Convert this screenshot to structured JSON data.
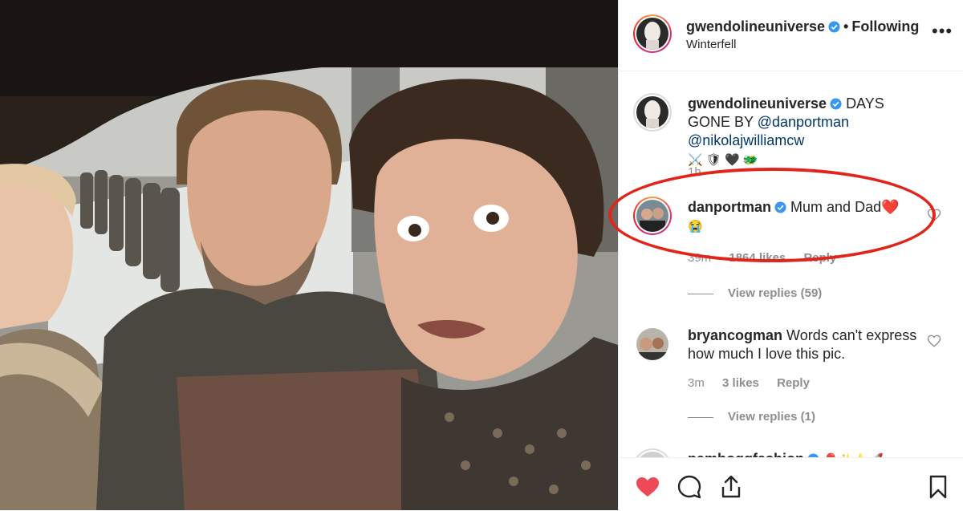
{
  "post": {
    "author": "gwendolineuniverse",
    "follow_status": "Following",
    "location": "Winterfell"
  },
  "caption": {
    "username": "gwendolineuniverse",
    "text": "DAYS GONE BY",
    "mentions": [
      "@danportman",
      "@nikolajwilliamcw"
    ],
    "emojis": "⚔️ 🛡 🖤 🐲",
    "time": "1h"
  },
  "comments": [
    {
      "username": "danportman",
      "verified": true,
      "text": "Mum and Dad❤️",
      "emoji_line": "😭",
      "time": "39m",
      "likes": "1864 likes",
      "reply_label": "Reply",
      "view_replies": "View replies (59)"
    },
    {
      "username": "bryancogman",
      "verified": false,
      "text": "Words can't express how much I love this pic.",
      "time": "3m",
      "likes": "3 likes",
      "reply_label": "Reply",
      "view_replies": "View replies (1)"
    },
    {
      "username": "pamhoggfashion",
      "verified": true,
      "text": "🎈✨⭐🚀"
    }
  ],
  "icons": {
    "like": "heart-icon",
    "comment": "comment-icon",
    "share": "share-icon",
    "save": "bookmark-icon",
    "more": "more-options-icon"
  },
  "colors": {
    "like_red": "#ed4956",
    "mention_blue": "#00376b",
    "verified_blue": "#3897f0",
    "annotation_red": "#e1251b"
  }
}
